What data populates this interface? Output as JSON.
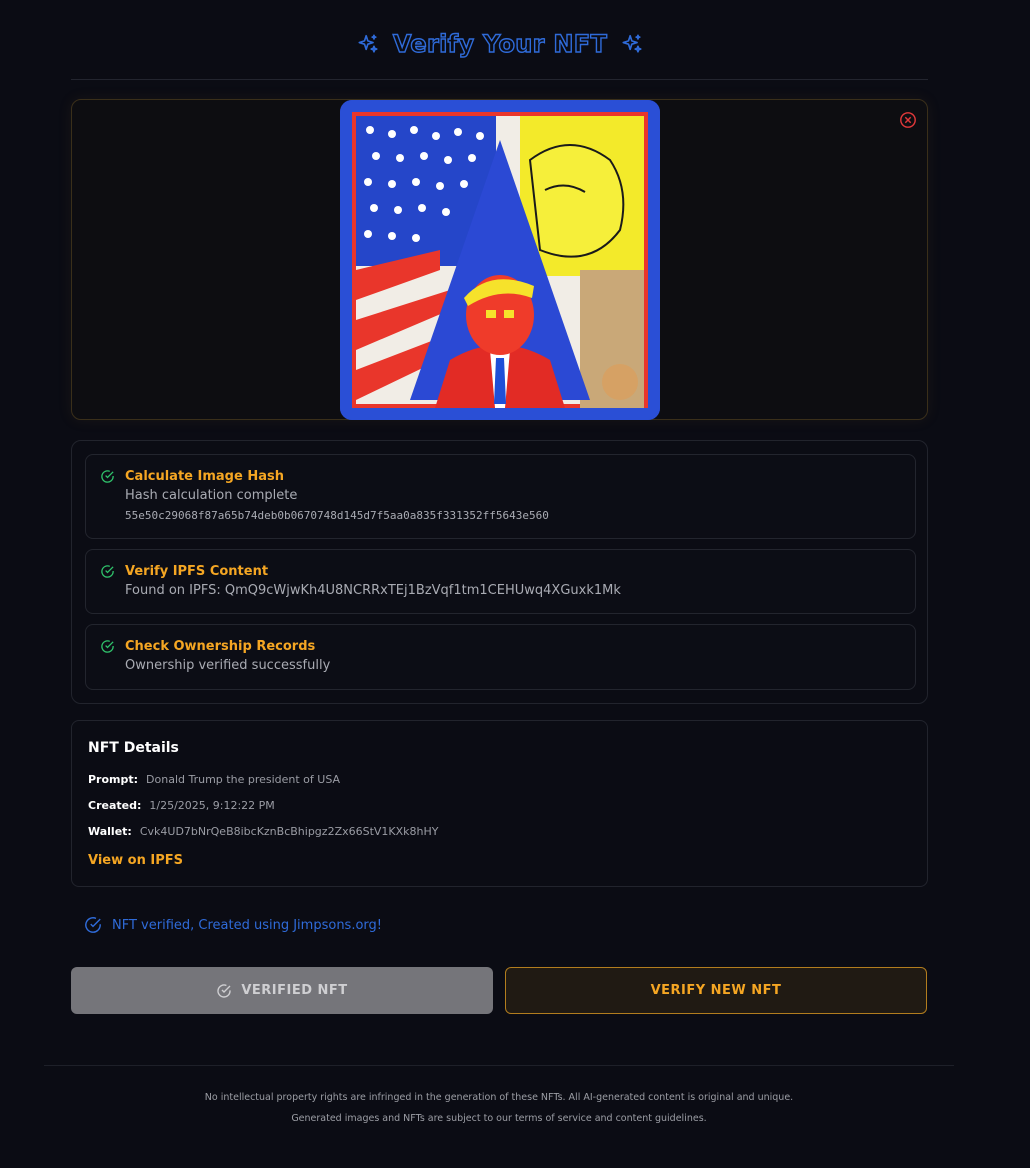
{
  "header": {
    "title": "Verify Your NFT",
    "left_icon": "sparkles-icon",
    "right_icon": "sparkles-icon"
  },
  "image_panel": {
    "remove_icon": "close-circle-icon"
  },
  "steps": [
    {
      "title": "Calculate Image Hash",
      "description": "Hash calculation complete",
      "hash": "55e50c29068f87a65b74deb0b0670748d145d7f5aa0a835f331352ff5643e560",
      "status_icon": "check-circle-icon"
    },
    {
      "title": "Verify IPFS Content",
      "description": "Found on IPFS: QmQ9cWjwKh4U8NCRRxTEj1BzVqf1tm1CEHUwq4XGuxk1Mk",
      "status_icon": "check-circle-icon"
    },
    {
      "title": "Check Ownership Records",
      "description": "Ownership verified successfully",
      "status_icon": "check-circle-icon"
    }
  ],
  "details": {
    "heading": "NFT Details",
    "prompt_label": "Prompt:",
    "prompt_value": "Donald Trump the president of USA",
    "created_label": "Created:",
    "created_value": "1/25/2025, 9:12:22 PM",
    "wallet_label": "Wallet:",
    "wallet_value": "Cvk4UD7bNrQeB8ibcKznBcBhipgz2Zx66StV1KXk8hHY",
    "link_label": "View on IPFS"
  },
  "verified_message": "NFT verified, Created using Jimpsons.org!",
  "buttons": {
    "verified_label": "VERIFIED NFT",
    "new_label": "VERIFY NEW NFT"
  },
  "footer": {
    "line1": "No intellectual property rights are infringed in the generation of these NFTs. All AI-generated content is original and unique.",
    "line2": "Generated images and NFTs are subject to our terms of service and content guidelines."
  },
  "colors": {
    "accent_orange": "#f5a623",
    "accent_blue": "#2f6bd9",
    "success_green": "#2fc26b",
    "error_red": "#e0383a",
    "background": "#0b0c14"
  }
}
